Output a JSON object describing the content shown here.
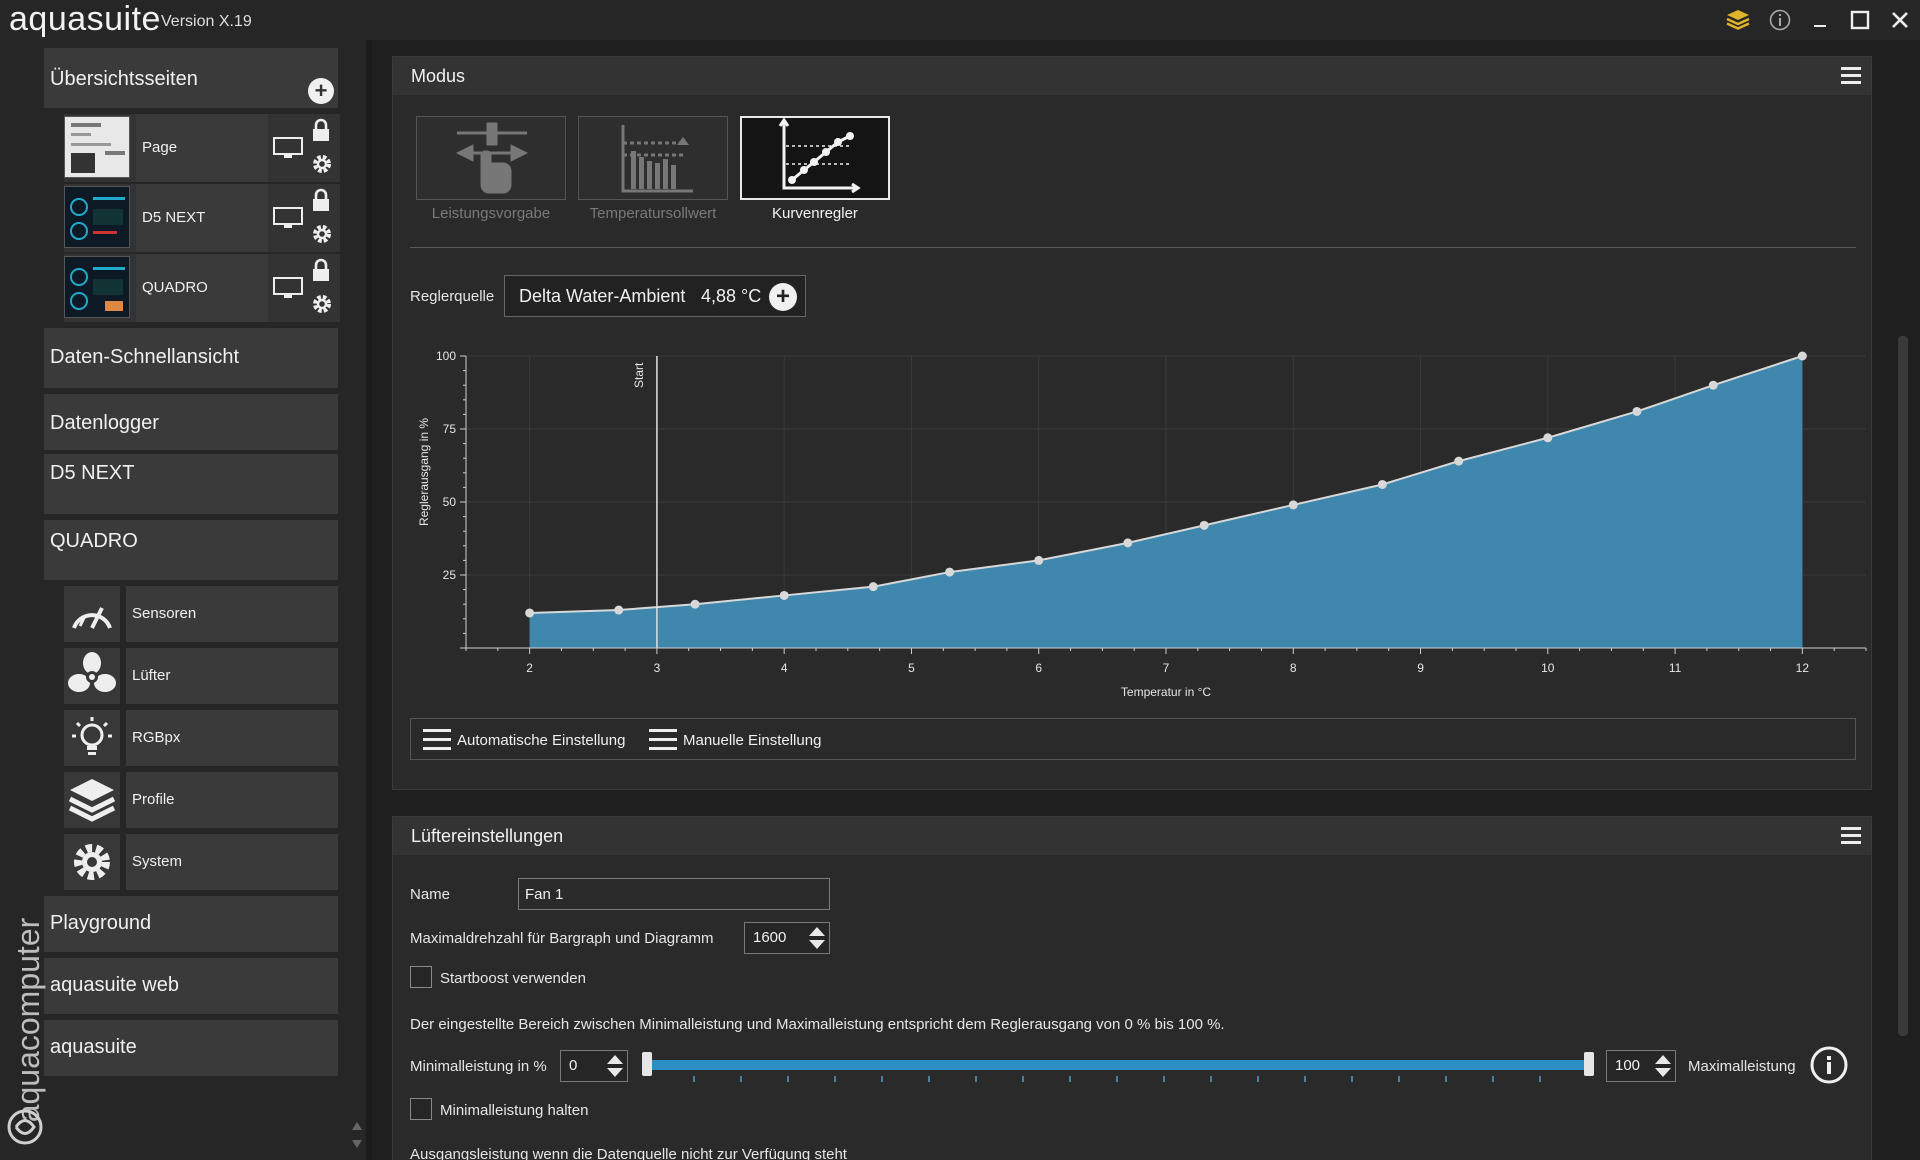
{
  "app": {
    "name": "aquasuite",
    "version": "Version X.19",
    "brand_vertical": "aquacomputer"
  },
  "sidebar": {
    "overview_title": "Übersichtsseiten",
    "pages": [
      {
        "label": "Page"
      },
      {
        "label": "D5 NEXT"
      },
      {
        "label": "QUADRO"
      }
    ],
    "items": [
      {
        "label": "Daten-Schnellansicht"
      },
      {
        "label": "Datenlogger"
      },
      {
        "label": "D5 NEXT"
      },
      {
        "label": "QUADRO"
      }
    ],
    "sub_items": [
      {
        "label": "Sensoren",
        "icon": "gauge-icon"
      },
      {
        "label": "Lüfter",
        "icon": "fan-icon"
      },
      {
        "label": "RGBpx",
        "icon": "lightbulb-icon"
      },
      {
        "label": "Profile",
        "icon": "layers-icon"
      },
      {
        "label": "System",
        "icon": "gear-icon"
      }
    ],
    "bottom_items": [
      {
        "label": "Playground"
      },
      {
        "label": "aquasuite web"
      },
      {
        "label": "aquasuite"
      }
    ]
  },
  "mode_panel": {
    "title": "Modus",
    "modes": [
      {
        "label": "Leistungsvorgabe",
        "active": false
      },
      {
        "label": "Temperatursollwert",
        "active": false
      },
      {
        "label": "Kurvenregler",
        "active": true
      }
    ],
    "source_label": "Reglerquelle",
    "source_name": "Delta Water-Ambient",
    "source_value": "4,88 °C",
    "auto_label": "Automatische Einstellung",
    "manual_label": "Manuelle Einstellung"
  },
  "chart_data": {
    "type": "area",
    "xlabel": "Temperatur in °C",
    "ylabel": "Reglerausgang in %",
    "xlim": [
      1.5,
      12.5
    ],
    "ylim": [
      0,
      100
    ],
    "xticks": [
      2,
      3,
      4,
      5,
      6,
      7,
      8,
      9,
      10,
      11,
      12
    ],
    "yticks": [
      25,
      50,
      75,
      100
    ],
    "marker_label": "Start",
    "marker_x": 3,
    "grid": true,
    "color": "#3f87ad",
    "x": [
      2,
      2.7,
      3.3,
      4,
      4.7,
      5.3,
      6,
      6.7,
      7.3,
      8,
      8.7,
      9.3,
      10,
      10.7,
      11.3,
      12
    ],
    "y": [
      12,
      13,
      15,
      18,
      21,
      26,
      30,
      36,
      42,
      49,
      56,
      64,
      72,
      81,
      90,
      100
    ]
  },
  "fan_panel": {
    "title": "Lüftereinstellungen",
    "name_label": "Name",
    "name_value": "Fan 1",
    "maxrpm_label": "Maximaldrehzahl für Bargraph und Diagramm",
    "maxrpm_value": "1600",
    "startboost_label": "Startboost verwenden",
    "range_note": "Der eingestellte Bereich zwischen Minimalleistung und Maximalleistung entspricht dem Reglerausgang von 0 % bis 100 %.",
    "min_label": "Minimalleistung in %",
    "min_value": "0",
    "max_value": "100",
    "max_label": "Maximalleistung",
    "hold_min_label": "Minimalleistung halten",
    "cutoff_text": "Ausgangsleistung wenn die Datenquelle nicht zur Verfügung steht",
    "slider": {
      "min": 0,
      "max": 100
    }
  }
}
